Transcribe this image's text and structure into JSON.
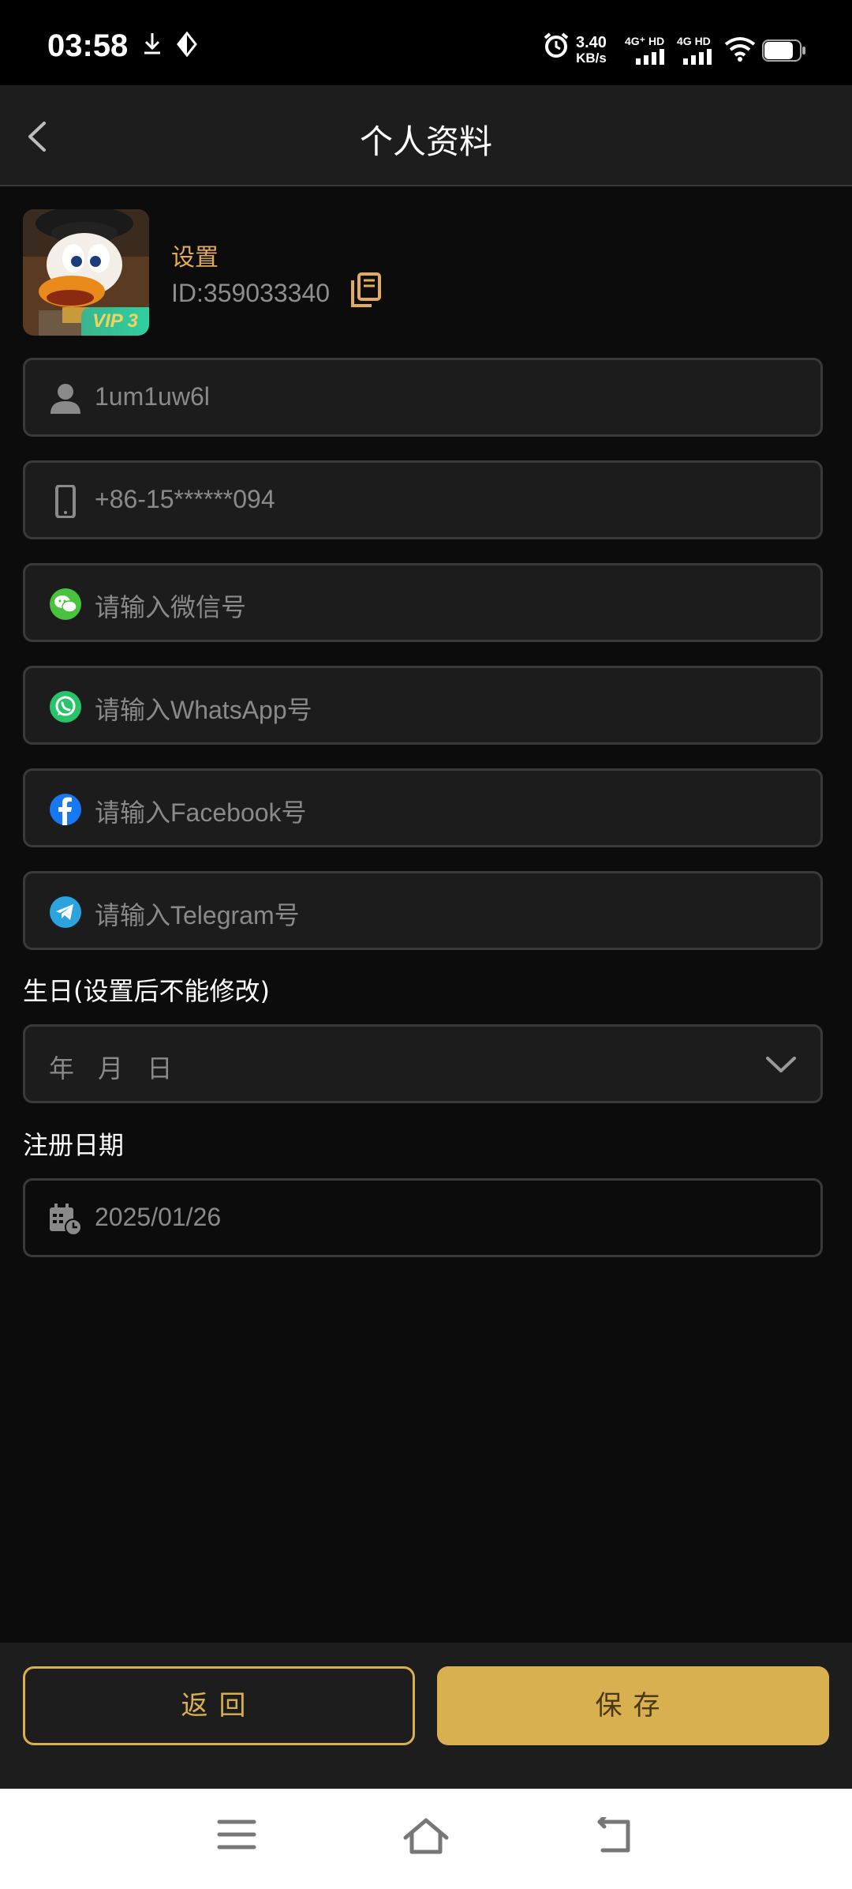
{
  "status": {
    "time": "03:58",
    "speed_value": "3.40",
    "speed_unit": "KB/s",
    "net1": "4G⁺ HD",
    "net2": "4G HD"
  },
  "header": {
    "title": "个人资料"
  },
  "profile": {
    "nickname": "设置",
    "id_text": "ID:359033340",
    "vip_badge": "VIP 3"
  },
  "fields": {
    "username": {
      "value": "1um1uw6l"
    },
    "phone": {
      "value": "+86-15******094"
    },
    "wechat": {
      "placeholder": "请输入微信号"
    },
    "whatsapp": {
      "placeholder": "请输入WhatsApp号"
    },
    "facebook": {
      "placeholder": "请输入Facebook号"
    },
    "telegram": {
      "placeholder": "请输入Telegram号"
    }
  },
  "birthday": {
    "label": "生日(设置后不能修改)",
    "placeholder": "年 月 日"
  },
  "register": {
    "label": "注册日期",
    "date": "2025/01/26"
  },
  "footer": {
    "back_label": "返回",
    "save_label": "保存"
  },
  "colors": {
    "accent": "#d8b050",
    "nickname": "#e2ad5b",
    "background": "#0c0c0c",
    "field_bg": "#1c1c1c"
  },
  "icons": [
    "user-icon",
    "phone-icon",
    "wechat-icon",
    "whatsapp-icon",
    "facebook-icon",
    "telegram-icon",
    "calendar-icon",
    "copy-icon",
    "chevron-down-icon",
    "back-arrow-icon"
  ]
}
